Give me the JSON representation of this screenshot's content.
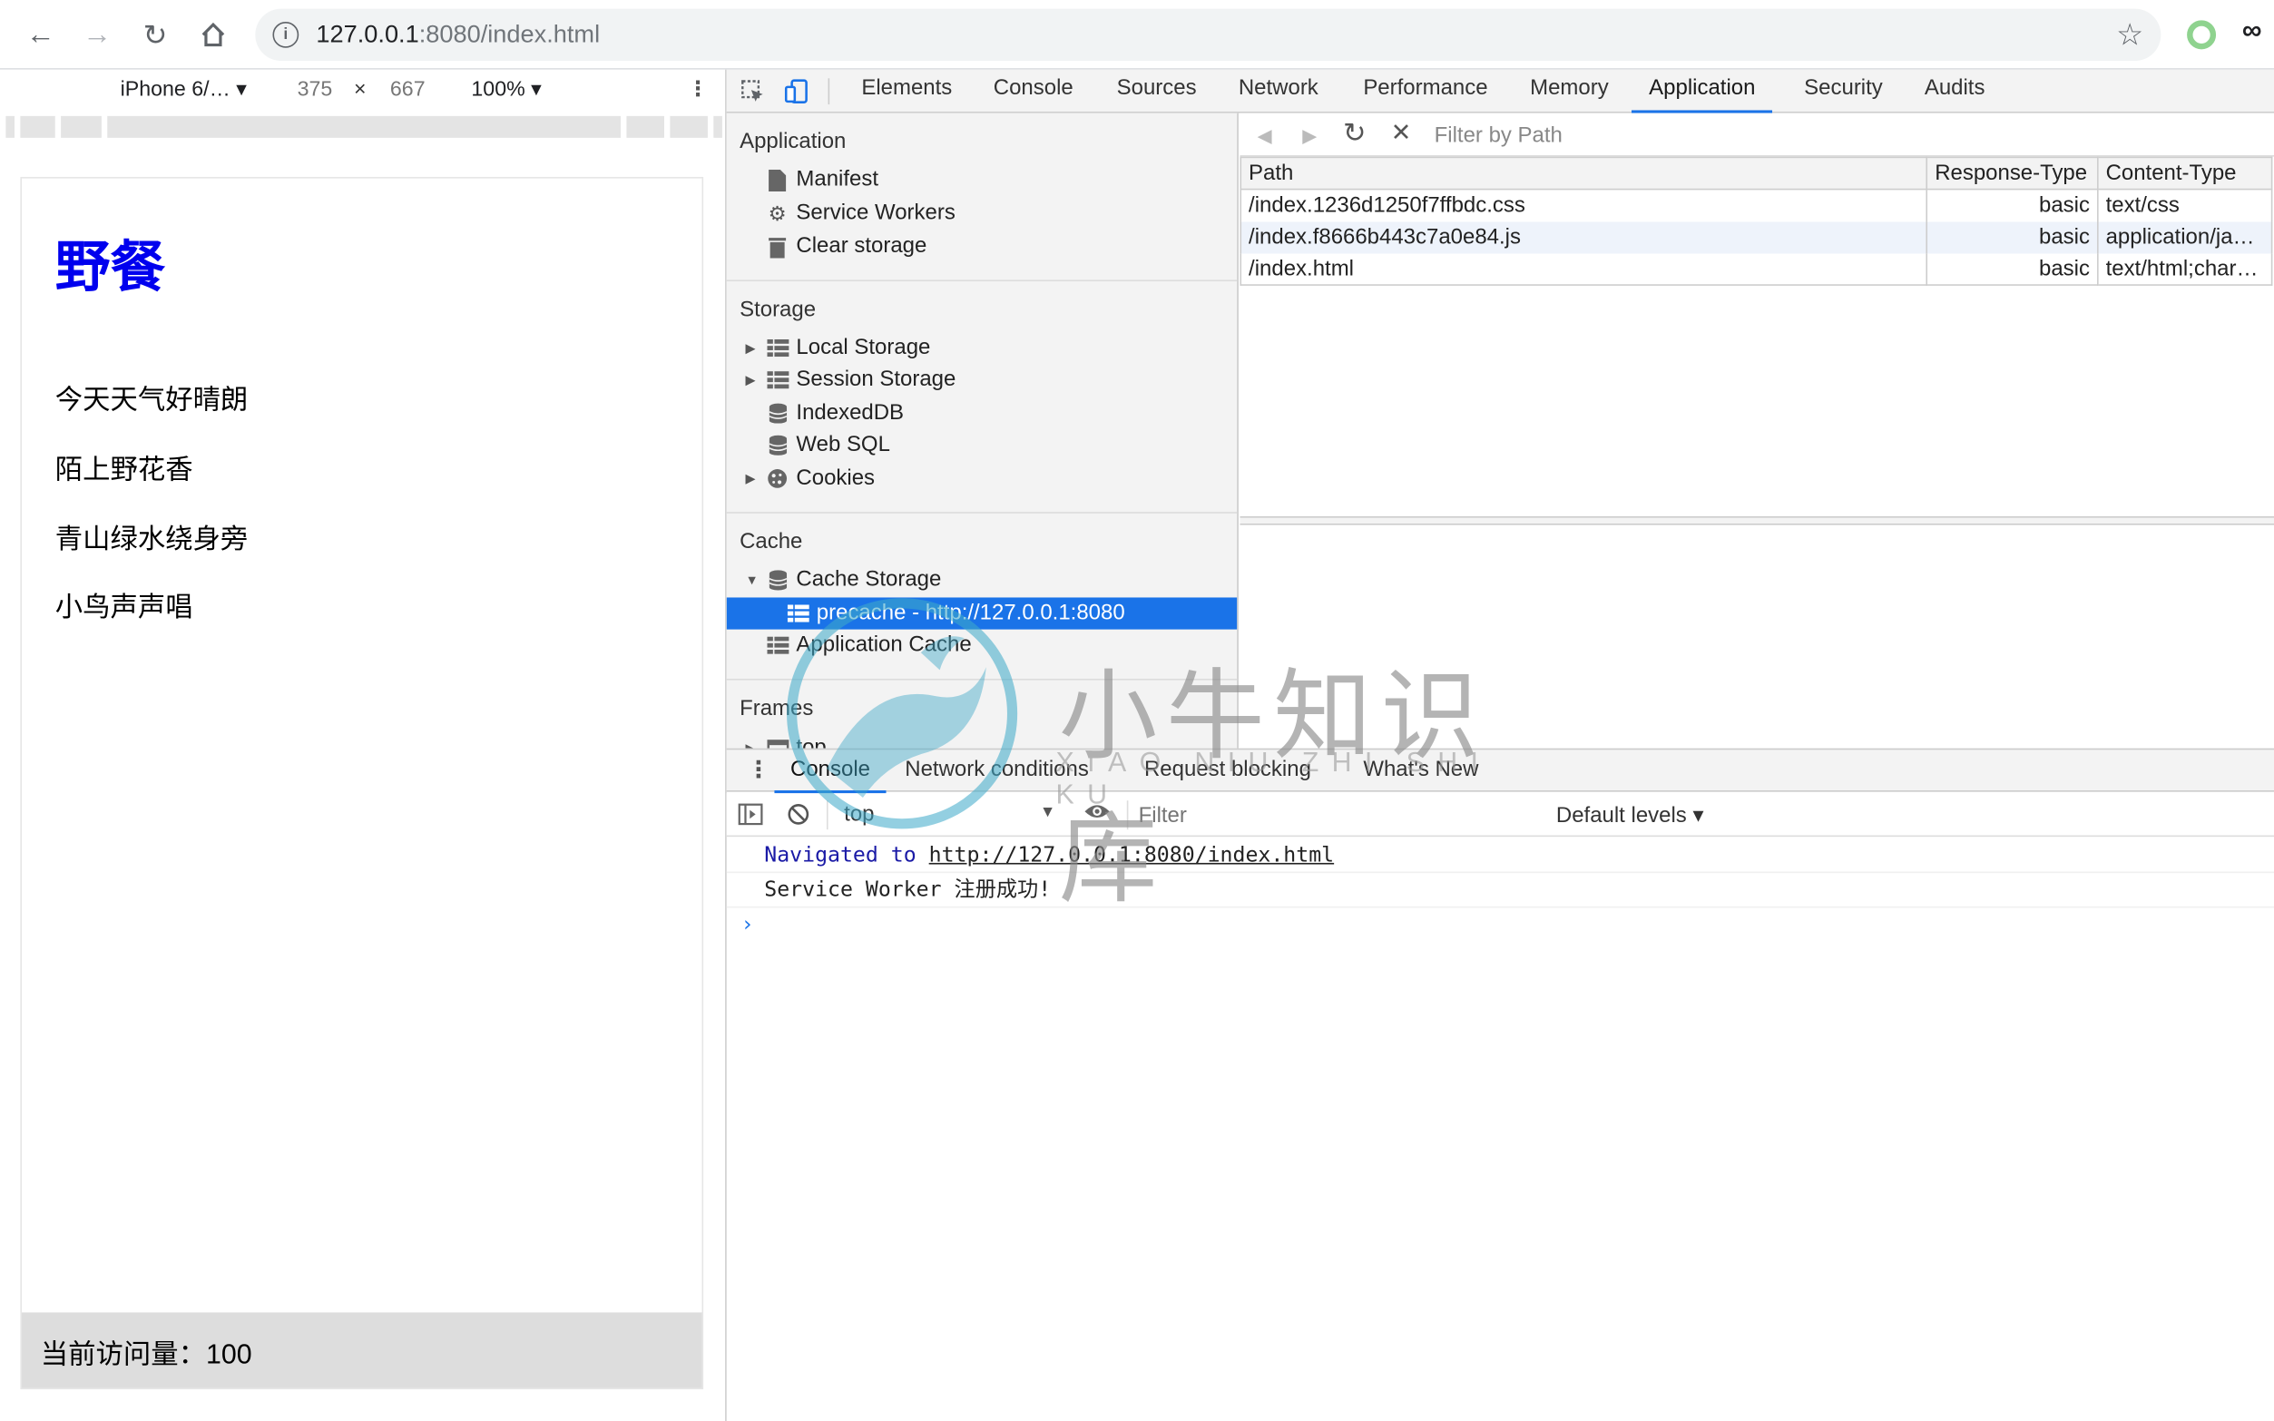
{
  "browser": {
    "url_host": "127.0.0.1",
    "url_rest": ":8080/index.html"
  },
  "device_toolbar": {
    "device": "iPhone 6/…",
    "width": "375",
    "times": "×",
    "height": "667",
    "zoom": "100%"
  },
  "page": {
    "title": "野餐",
    "lines": [
      "今天天气好晴朗",
      "陌上野花香",
      "青山绿水绕身旁",
      "小鸟声声唱"
    ],
    "footer": "当前访问量：100"
  },
  "devtools": {
    "tabs": [
      "Elements",
      "Console",
      "Sources",
      "Network",
      "Performance",
      "Memory",
      "Application",
      "Security",
      "Audits"
    ],
    "active_tab": "Application",
    "sidebar": {
      "application_head": "Application",
      "application_items": [
        "Manifest",
        "Service Workers",
        "Clear storage"
      ],
      "storage_head": "Storage",
      "storage_items": [
        "Local Storage",
        "Session Storage",
        "IndexedDB",
        "Web SQL",
        "Cookies"
      ],
      "cache_head": "Cache",
      "cache_items": [
        "Cache Storage",
        "precache - http://127.0.0.1:8080",
        "Application Cache"
      ],
      "frames_head": "Frames",
      "frames_items": [
        "top"
      ]
    },
    "filter_placeholder": "Filter by Path",
    "table": {
      "headers": [
        "Path",
        "Response-Type",
        "Content-Type"
      ],
      "rows": [
        [
          "/index.1236d1250f7ffbdc.css",
          "basic",
          "text/css"
        ],
        [
          "/index.f8666b443c7a0e84.js",
          "basic",
          "application/ja…"
        ],
        [
          "/index.html",
          "basic",
          "text/html;char…"
        ]
      ]
    },
    "drawer_tabs": [
      "Console",
      "Network conditions",
      "Request blocking",
      "What's New"
    ],
    "console_context": "top",
    "console_filter_placeholder": "Filter",
    "console_levels": "Default levels ▾",
    "console_messages": {
      "nav_prefix": "Navigated to ",
      "nav_url": "http://127.0.0.1:8080/index.html",
      "log": "Service Worker 注册成功!"
    },
    "prompt": "›"
  },
  "watermark": {
    "text": "小牛知识库",
    "pinyin": "XIAO NIU ZHI SHI KU"
  },
  "colors": {
    "accent": "#1a73e8",
    "page_title": "#0000ee",
    "footer_bg": "#dddddd"
  }
}
